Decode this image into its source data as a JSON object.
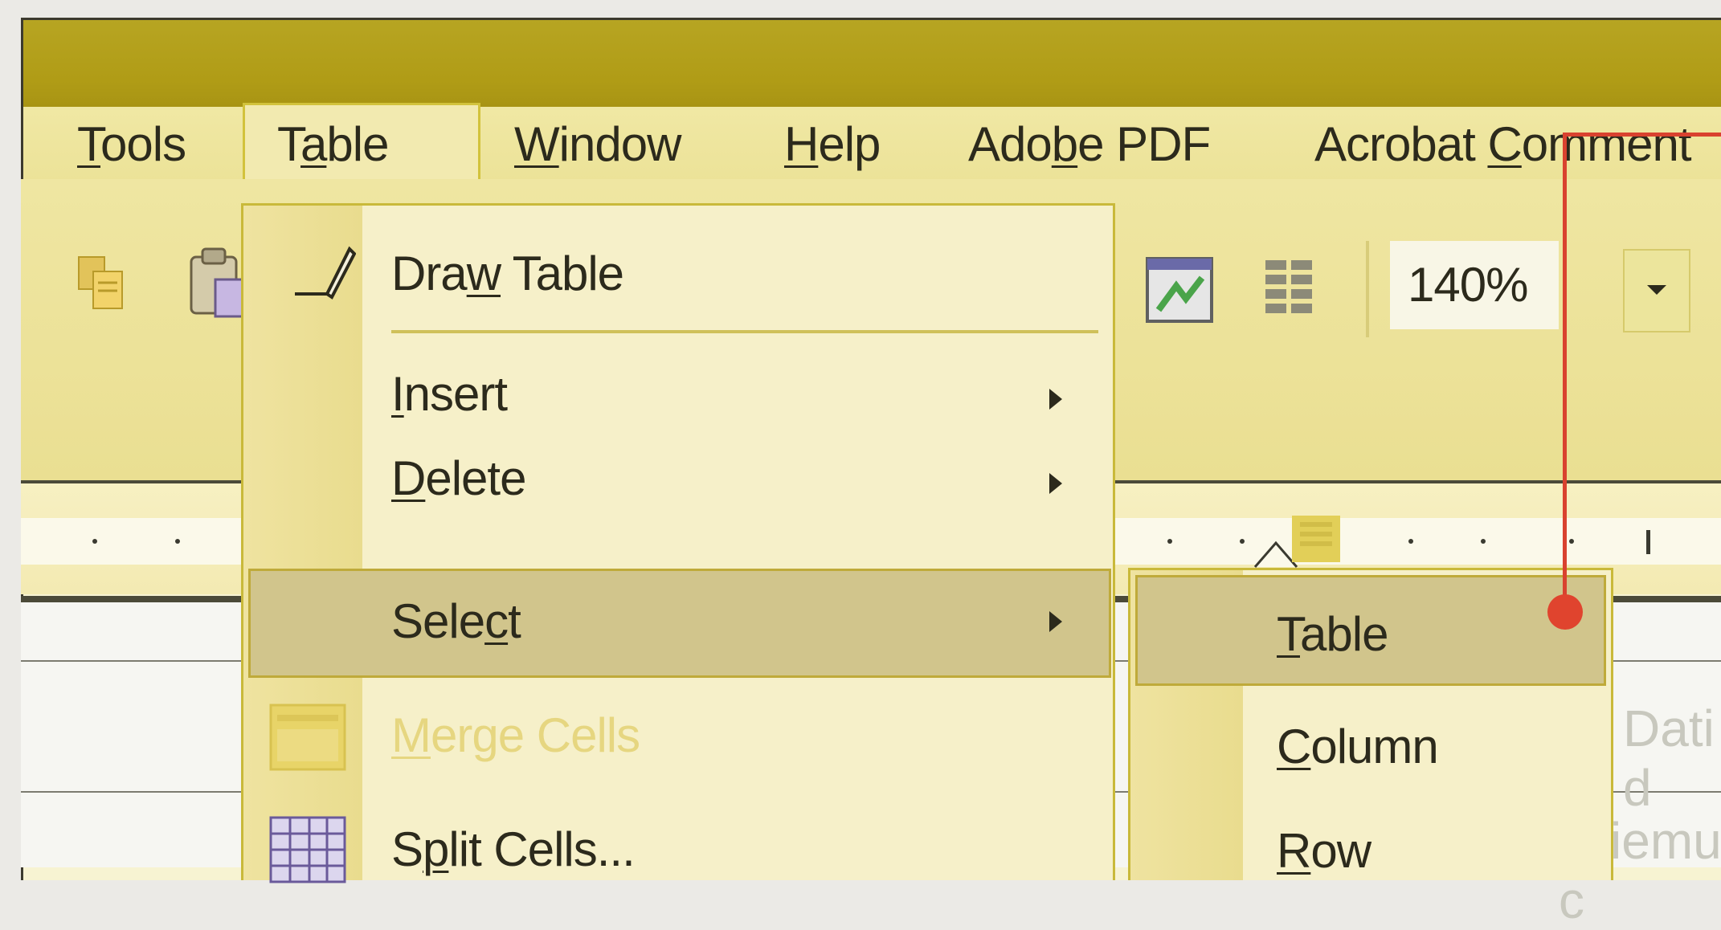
{
  "menubar": {
    "items": [
      {
        "id": "tools",
        "pre": "",
        "u": "T",
        "post": "ools"
      },
      {
        "id": "table",
        "pre": "T",
        "u": "a",
        "post": "ble"
      },
      {
        "id": "window",
        "pre": "",
        "u": "W",
        "post": "indow"
      },
      {
        "id": "help",
        "pre": "",
        "u": "H",
        "post": "elp"
      },
      {
        "id": "adobe-pdf",
        "pre": "Ado",
        "u": "b",
        "post": "e PDF"
      },
      {
        "id": "acrobat-comments",
        "pre": "Acrobat ",
        "u": "C",
        "post": "omment"
      }
    ]
  },
  "toolbar": {
    "zoom": "140%"
  },
  "table_menu": {
    "draw_table": {
      "pre": "Dra",
      "u": "w",
      "post": " Table"
    },
    "insert": {
      "pre": "",
      "u": "I",
      "post": "nsert"
    },
    "delete": {
      "pre": "",
      "u": "D",
      "post": "elete"
    },
    "select": {
      "pre": "Sele",
      "u": "c",
      "post": "t"
    },
    "merge_cells": {
      "pre": "",
      "u": "M",
      "post": "erge Cells"
    },
    "split_cells": {
      "pre": "S",
      "u": "p",
      "post": "lit Cells..."
    }
  },
  "select_submenu": {
    "table": {
      "pre": "",
      "u": "T",
      "post": "able"
    },
    "column": {
      "pre": "",
      "u": "C",
      "post": "olumn"
    },
    "row": {
      "pre": "",
      "u": "R",
      "post": "ow"
    }
  },
  "document": {
    "text_line1": "Dati d",
    "text_line2": "fisiemul c"
  },
  "colors": {
    "title_bar": "#b09c16",
    "menu_bg": "#ebe195",
    "highlight": "#d1c58c",
    "callout": "#e0442e"
  }
}
